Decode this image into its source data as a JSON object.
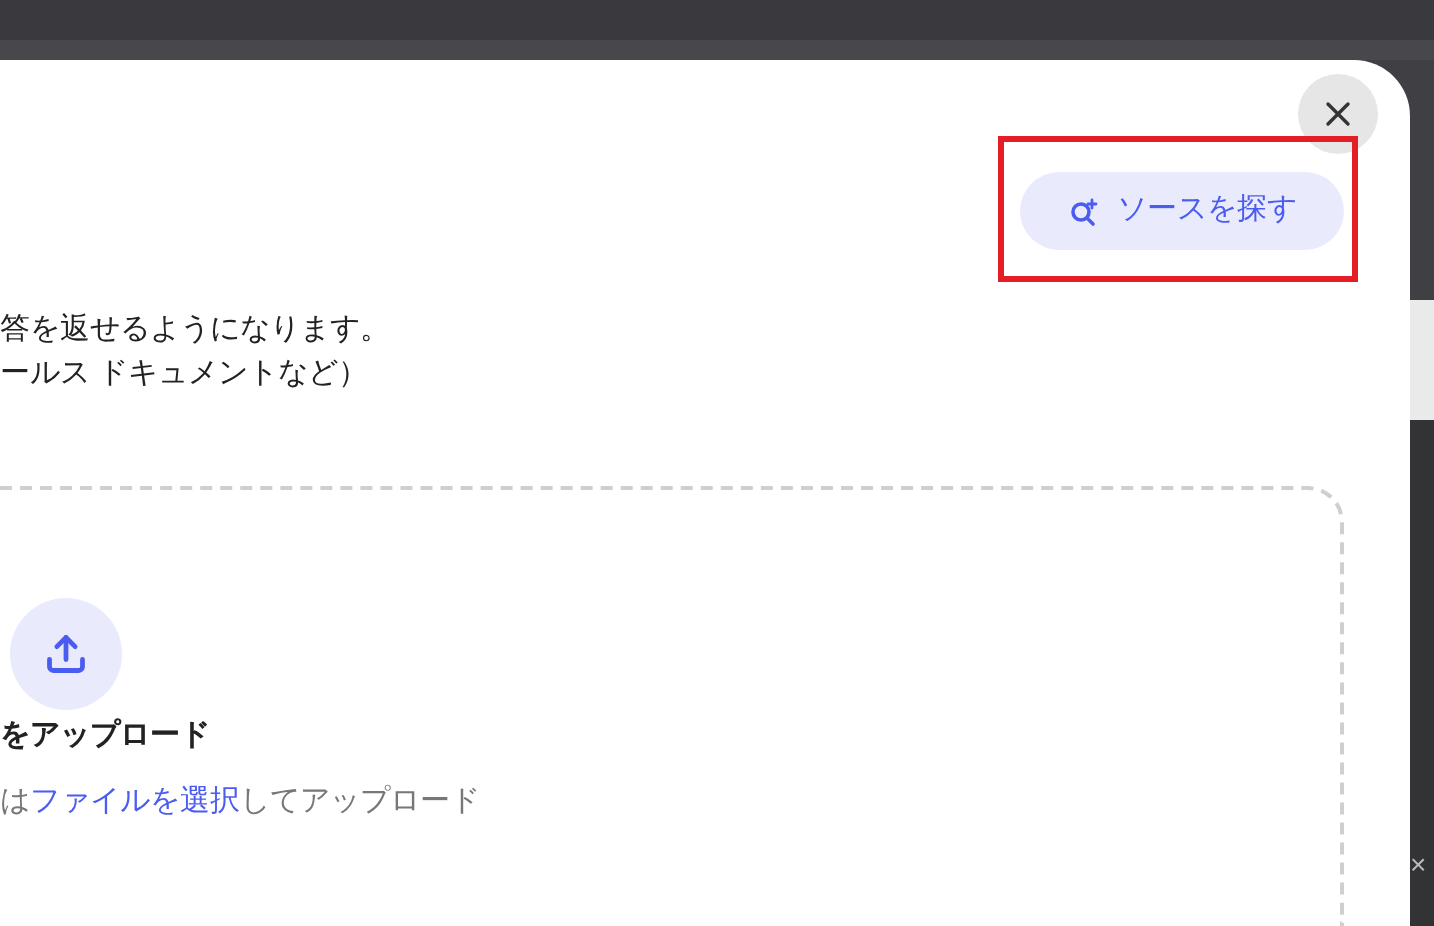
{
  "background": {
    "right_edge_texts": [
      "×"
    ]
  },
  "dialog": {
    "find_sources_button": "ソースを探す",
    "description_lines": [
      "答を返せるようになります。",
      "ールス ドキュメントなど）"
    ],
    "upload": {
      "title": "をアップロード",
      "hint_before": "は",
      "hint_link": "ファイルを選択",
      "hint_after": "してアップロード"
    }
  }
}
